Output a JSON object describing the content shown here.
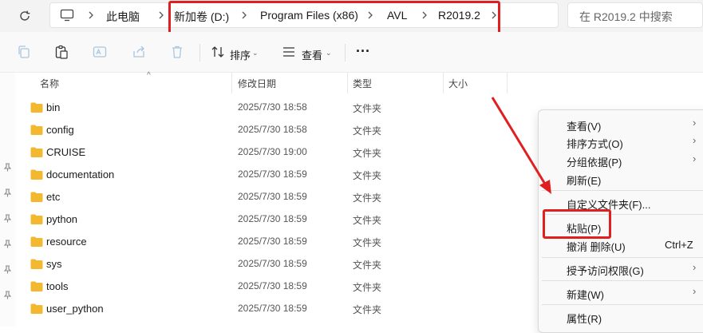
{
  "address": {
    "crumbs": [
      "此电脑",
      "新加卷 (D:)",
      "Program Files (x86)",
      "AVL",
      "R2019.2"
    ],
    "search_placeholder": "在 R2019.2 中搜索"
  },
  "toolbar": {
    "sort_label": "排序",
    "view_label": "查看",
    "more_label": "···"
  },
  "columns": {
    "name": "名称",
    "date": "修改日期",
    "type": "类型",
    "size": "大小"
  },
  "files": [
    {
      "name": "bin",
      "date": "2025/7/30 18:58",
      "type": "文件夹"
    },
    {
      "name": "config",
      "date": "2025/7/30 18:58",
      "type": "文件夹"
    },
    {
      "name": "CRUISE",
      "date": "2025/7/30 19:00",
      "type": "文件夹"
    },
    {
      "name": "documentation",
      "date": "2025/7/30 18:59",
      "type": "文件夹"
    },
    {
      "name": "etc",
      "date": "2025/7/30 18:59",
      "type": "文件夹"
    },
    {
      "name": "python",
      "date": "2025/7/30 18:59",
      "type": "文件夹"
    },
    {
      "name": "resource",
      "date": "2025/7/30 18:59",
      "type": "文件夹"
    },
    {
      "name": "sys",
      "date": "2025/7/30 18:59",
      "type": "文件夹"
    },
    {
      "name": "tools",
      "date": "2025/7/30 18:59",
      "type": "文件夹"
    },
    {
      "name": "user_python",
      "date": "2025/7/30 18:59",
      "type": "文件夹"
    }
  ],
  "context_menu": {
    "view": "查看(V)",
    "sort": "排序方式(O)",
    "group": "分组依据(P)",
    "refresh": "刷新(E)",
    "customize": "自定义文件夹(F)...",
    "paste": "粘贴(P)",
    "undo": "撤消 删除(U)",
    "undo_shortcut": "Ctrl+Z",
    "access": "授予访问权限(G)",
    "new": "新建(W)",
    "properties": "属性(R)",
    "submenu_chevron": "›"
  },
  "colors": {
    "folder": "#f2b930",
    "annotation": "#e02020"
  }
}
